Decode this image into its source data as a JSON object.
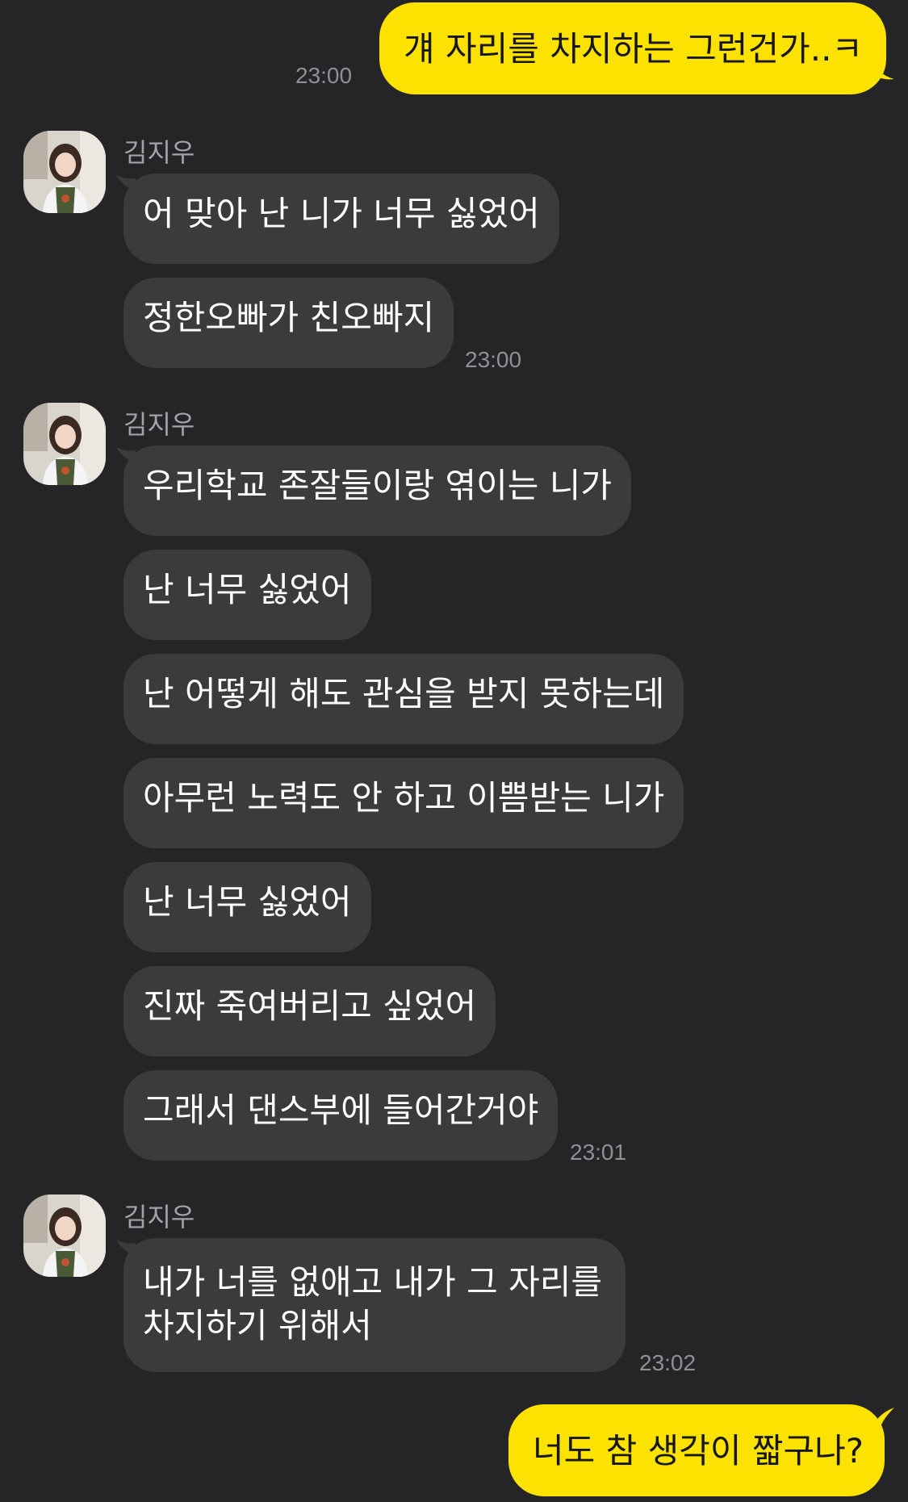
{
  "contact_name": "김지우",
  "colors": {
    "background": "#252527",
    "incoming": "#3b3b3e",
    "outgoing": "#fce200",
    "timestamp": "#8f8f95"
  },
  "messages": [
    {
      "side": "out",
      "text": "걔 자리를 차지하는 그런건가..ㅋ",
      "time": "23:00"
    },
    {
      "side": "in",
      "text": "어 맞아 난 니가 너무 싫었어"
    },
    {
      "side": "in",
      "text": "정한오빠가 친오빠지",
      "time": "23:00"
    },
    {
      "side": "in",
      "text": "우리학교 존잘들이랑 엮이는 니가"
    },
    {
      "side": "in",
      "text": "난 너무 싫었어"
    },
    {
      "side": "in",
      "text": "난 어떻게 해도 관심을 받지 못하는데"
    },
    {
      "side": "in",
      "text": "아무런 노력도 안 하고 이쁨받는 니가"
    },
    {
      "side": "in",
      "text": "난 너무 싫었어"
    },
    {
      "side": "in",
      "text": "진짜 죽여버리고 싶었어"
    },
    {
      "side": "in",
      "text": "그래서 댄스부에 들어간거야",
      "time": "23:01"
    },
    {
      "side": "in",
      "text_line1": "내가 너를 없애고 내가 그 자리를",
      "text_line2": "차지하기 위해서",
      "time": "23:02"
    },
    {
      "side": "out",
      "text": "너도 참 생각이 짧구나?"
    }
  ],
  "avatar_icon": "profile-photo-girl-in-green-vest"
}
